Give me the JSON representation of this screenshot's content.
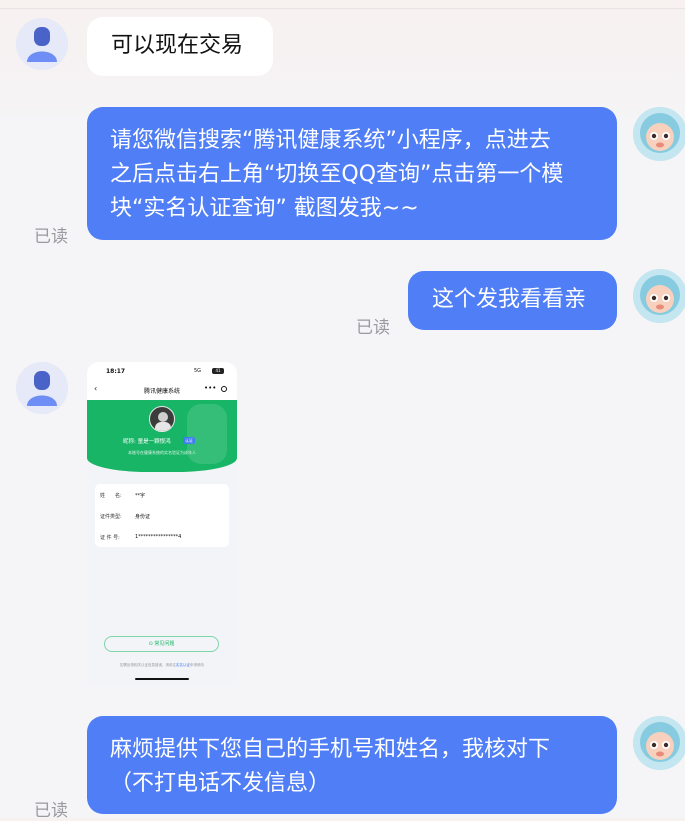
{
  "messages": [
    {
      "sender": "other",
      "text": "可以现在交易"
    },
    {
      "sender": "me",
      "line1": "请您微信搜索“腾讯健康系统”小程序，点进去",
      "line2": "之后点击右上角“切换至QQ查询”点击第一个模",
      "line3": "块“实名认证查询” 截图发我~~",
      "status": "已读"
    },
    {
      "sender": "me",
      "text": "这个发我看看亲",
      "status": "已读"
    },
    {
      "sender": "other",
      "type": "image"
    },
    {
      "sender": "me",
      "line1": "麻烦提供下您自己的手机号和姓名，我核对下",
      "line2": "（不打电话不发信息）",
      "status": "已读"
    }
  ],
  "screenshot": {
    "time": "18:17",
    "signal": "5G",
    "battery": "41",
    "nav_title": "腾讯健康系统",
    "nickname": "昵称: 童是一颗恨鸿",
    "tag": "认证",
    "subtitle": "本账号在健康系统的实名验证为成年人",
    "rows": [
      {
        "label": "姓　　名:",
        "value": "**宇"
      },
      {
        "label": "证件类型:",
        "value": "身份证"
      },
      {
        "label": "证 件 号:",
        "value": "1****************4"
      }
    ],
    "faq_button": "常见问题",
    "footer_prefix": "如需反馈相关认证信息错误，请前往",
    "footer_link": "实名认证",
    "footer_suffix": "申请修改",
    "colors": {
      "header_green": "#19b566"
    }
  }
}
